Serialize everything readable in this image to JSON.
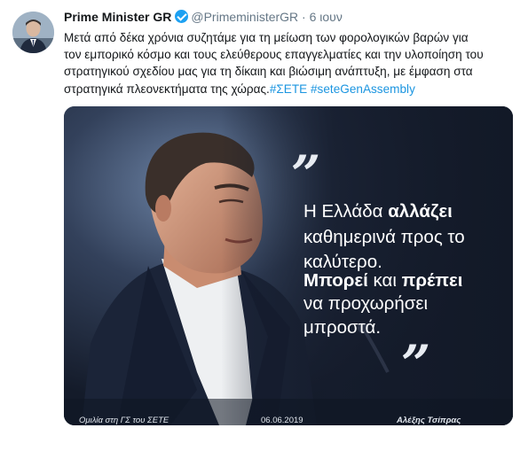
{
  "tweet": {
    "author_name": "Prime Minister GR",
    "handle": "@PrimeministerGR",
    "separator": "·",
    "time": "6 ιουν",
    "text_lines": [
      "Μετά από δέκα χρόνια συζητάμε για τη μείωση των φορολογικών βαρών για",
      "τον εμπορικό κόσμο και τους ελεύθερους επαγγελματίες και την υλοποίηση του",
      "στρατηγικού σχεδίου μας για τη δίκαιη και βιώσιμη ανάπτυξη, με έμφαση στα",
      "στρατηγικά πλεονεκτήματα της χώρας."
    ],
    "hashtags": [
      "#ΣΕΤΕ",
      "#seteGenAssembly"
    ]
  },
  "media": {
    "quote_lines": [
      {
        "normal1": "Η Ελλάδα ",
        "bold1": "αλλάζει",
        "normal2": "",
        "bold2": "",
        "normal3": ""
      },
      {
        "normal1": "καθημερινά προς το",
        "bold1": "",
        "normal2": "",
        "bold2": "",
        "normal3": ""
      },
      {
        "normal1": "καλύτερο.",
        "bold1": "",
        "normal2": "",
        "bold2": "",
        "normal3": ""
      },
      {
        "normal1": "",
        "bold1": "Μπορεί",
        "normal2": " και ",
        "bold2": "πρέπει",
        "normal3": ""
      },
      {
        "normal1": "να προχωρήσει",
        "bold1": "",
        "normal2": "",
        "bold2": "",
        "normal3": ""
      },
      {
        "normal1": "μπροστά.",
        "bold1": "",
        "normal2": "",
        "bold2": "",
        "normal3": ""
      }
    ],
    "open_quote": "”",
    "close_quote": "”",
    "footer_left": "Ομιλία στη ΓΣ του ΣΕΤΕ",
    "footer_date": "06.06.2019",
    "footer_right": "Αλέξης Τσίπρας"
  },
  "colors": {
    "link": "#1b95e0",
    "verified": "#1da1f2",
    "media_bg": "#1d2638"
  }
}
